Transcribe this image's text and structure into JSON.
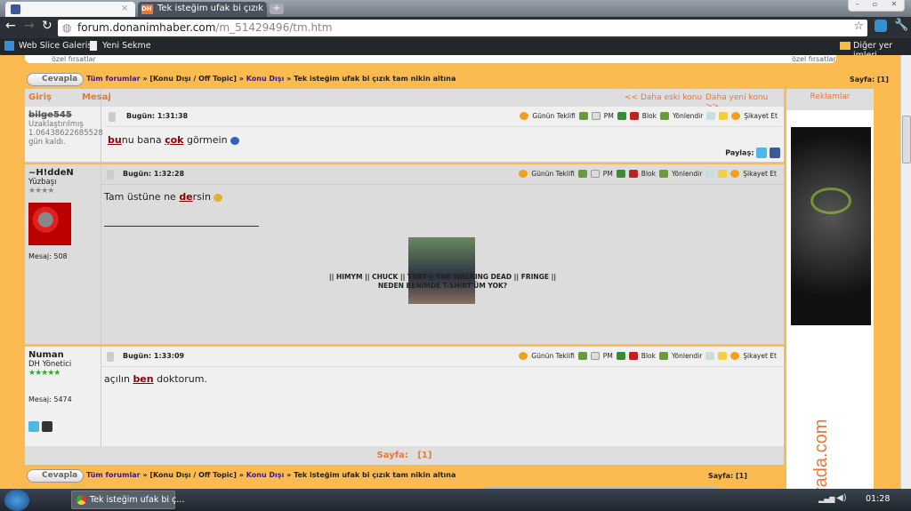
{
  "browser": {
    "tabs": [
      {
        "label": "",
        "icon": "facebook-icon"
      },
      {
        "label": "Tek isteğim ufak bi çızık t...",
        "icon": "dh-icon"
      }
    ],
    "address": {
      "host": "forum.donanimhaber.com",
      "path": "/m_51429496/tm.htm"
    },
    "bookmarks": [
      "Web Slice Galerisi",
      "Yeni Sekme"
    ],
    "other_bookmarks": "Diğer yer imleri"
  },
  "page": {
    "top_remnant": "özel fırsatlar",
    "reply_label": "Cevapla",
    "breadcrumb": {
      "all": "Tüm forumlar",
      "sep": "»",
      "cat": "[Konu Dışı / Off Topic]",
      "sub": "Konu Dışı",
      "title": "Tek isteğim ufak bi çızık tam nikin altına"
    },
    "page_label": "Sayfa:",
    "page_value": "[1]",
    "header": {
      "login": "Giriş",
      "message": "Mesaj",
      "older": "<< Daha eski konu",
      "newer": "Daha yeni konu >>"
    },
    "actions": {
      "offer": "Günün Teklifi",
      "pm": "PM",
      "block": "Blok",
      "forward": "Yönlendir",
      "report": "Şikayet Et"
    },
    "share_label": "Paylaş:",
    "posts": [
      {
        "user": "bilge545",
        "rank": "Uzaklaştırılmış",
        "extra": "1.06438622685528 gün kaldı.",
        "time": "Bugün: 1:31:38",
        "text": [
          "bu",
          "nu bana ",
          "çok",
          " görmein"
        ]
      },
      {
        "user": "~H!ddeN",
        "rank": "Yüzbaşı",
        "stars": 4,
        "posts_label": "Mesaj: 508",
        "time": "Bugün: 1:32:28",
        "text": [
          "Tam üstüne ne ",
          "de",
          "rsin"
        ],
        "signature": [
          "|| HIMYM || CHUCK || TBBT || THE WALKING DEAD || FRINGE ||",
          "NEDEN BENİMDE T-SHIRT'ÜM YOK?"
        ]
      },
      {
        "user": "Numan",
        "rank": "DH Yönetici",
        "stars": 5,
        "posts_label": "Mesaj: 5474",
        "time": "Bugün: 1:33:09",
        "text": [
          "açılın ",
          "ben",
          " doktorum."
        ]
      }
    ],
    "footer_page": "Sayfa:   [1]",
    "sidebar": {
      "title": "Reklamlar",
      "ad_text": "rada.com"
    }
  },
  "taskbar": {
    "window": "Tek isteğim ufak bi ç...",
    "clock": "01:28"
  },
  "colors": {
    "orange": "#fcbb50",
    "accent": "#e8773a",
    "link": "#3a1a8a",
    "highlight": "#8b0000"
  }
}
